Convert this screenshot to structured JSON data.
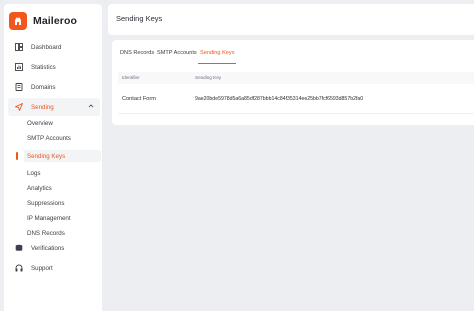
{
  "colors": {
    "accent": "#f2561d",
    "background": "#eceef1",
    "panel": "#ffffff"
  },
  "brand": {
    "name": "Maileroo"
  },
  "sidebar": {
    "items": [
      {
        "label": "Dashboard",
        "icon": "dashboard-icon"
      },
      {
        "label": "Statistics",
        "icon": "statistics-icon"
      },
      {
        "label": "Domains",
        "icon": "domains-icon"
      },
      {
        "label": "Sending",
        "icon": "send-icon",
        "active": true,
        "expanded": true,
        "children": [
          {
            "label": "Overview"
          },
          {
            "label": "SMTP Accounts"
          },
          {
            "label": "Sending Keys",
            "active": true
          },
          {
            "label": "Logs"
          },
          {
            "label": "Analytics"
          },
          {
            "label": "Suppressions"
          },
          {
            "label": "IP Management"
          },
          {
            "label": "DNS Records"
          }
        ]
      },
      {
        "label": "Verifications",
        "icon": "verifications-icon"
      },
      {
        "label": "Support",
        "icon": "headset-icon"
      }
    ]
  },
  "header": {
    "title": "Sending Keys"
  },
  "main": {
    "tabs": [
      {
        "label": "DNS Records"
      },
      {
        "label": "SMTP Accounts"
      },
      {
        "label": "Sending Keys",
        "active": true
      }
    ],
    "table": {
      "columns": [
        "Identifier",
        "Sending Key"
      ],
      "rows": [
        {
          "identifier": "Contact Form",
          "key": "9ae20bde5978d5a6a85df287bbb14c84f35314ee25bb7fcf6593d857b2fa0"
        }
      ]
    }
  }
}
